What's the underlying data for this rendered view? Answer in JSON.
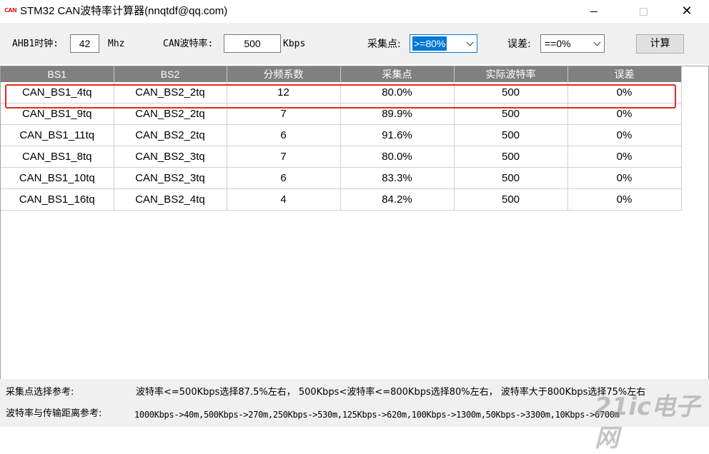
{
  "window": {
    "icon_text": "CAN",
    "title": "STM32 CAN波特率计算器(nnqtdf@qq.com)",
    "close_glyph": "✕"
  },
  "toolbar": {
    "ahb_label": "AHB1时钟:",
    "ahb_value": "42",
    "ahb_unit": "Mhz",
    "baud_label": "CAN波特率:",
    "baud_value": "500",
    "baud_unit": "Kbps",
    "sample_label": "采集点:",
    "sample_value": ">=80%",
    "error_label": "误差:",
    "error_value": "==0%",
    "calc_label": "计算"
  },
  "table": {
    "headers": [
      "BS1",
      "BS2",
      "分频系数",
      "采集点",
      "实际波特率",
      "误差"
    ],
    "rows": [
      [
        "CAN_BS1_4tq",
        "CAN_BS2_2tq",
        "12",
        "80.0%",
        "500",
        "0%"
      ],
      [
        "CAN_BS1_9tq",
        "CAN_BS2_2tq",
        "7",
        "89.9%",
        "500",
        "0%"
      ],
      [
        "CAN_BS1_11tq",
        "CAN_BS2_2tq",
        "6",
        "91.6%",
        "500",
        "0%"
      ],
      [
        "CAN_BS1_8tq",
        "CAN_BS2_3tq",
        "7",
        "80.0%",
        "500",
        "0%"
      ],
      [
        "CAN_BS1_10tq",
        "CAN_BS2_3tq",
        "6",
        "83.3%",
        "500",
        "0%"
      ],
      [
        "CAN_BS1_16tq",
        "CAN_BS2_4tq",
        "4",
        "84.2%",
        "500",
        "0%"
      ]
    ],
    "highlight_color": "#e8251c"
  },
  "footer": {
    "sample_ref_label": "采集点选择参考:",
    "sample_ref_text": "波特率<=500Kbps选择87.5%左右， 500Kbps<波特率<=800Kbps选择80%左右， 波特率大于800Kbps选择75%左右",
    "distance_ref_label": "波特率与传输距离参考:",
    "distance_ref_text": "1000Kbps->40m,500Kbps->270m,250Kbps->530m,125Kbps->620m,100Kbps->1300m,50Kbps->3300m,10Kbps->6700m"
  },
  "watermark": "21ic电子网"
}
